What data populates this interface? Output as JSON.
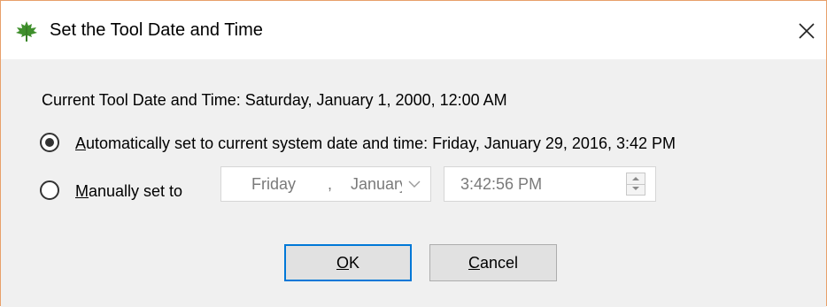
{
  "window": {
    "title": "Set the Tool Date and Time",
    "app_icon": "maple-leaf-icon",
    "close_icon": "close-icon",
    "accent_border_color": "#e8a06a"
  },
  "dialog": {
    "current_time_label": "Current Tool Date and Time: Saturday, January 1, 2000, 12:00 AM",
    "auto_option": {
      "label_mnemonic": "A",
      "label_rest": "utomatically set to current system date and time: Friday, January 29, 2016, 3:42 PM",
      "selected": true
    },
    "manual_option": {
      "label_mnemonic": "M",
      "label_rest": "anually set to",
      "selected": false
    },
    "date_picker": {
      "day": "Friday",
      "separator": ",",
      "month": "January",
      "dropdown_icon": "chevron-down-icon",
      "enabled": false
    },
    "time_picker": {
      "value": "3:42:56 PM",
      "spinner_icon": "spin-up-down-icon",
      "enabled": false
    },
    "buttons": {
      "ok_mnemonic": "O",
      "ok_rest": "K",
      "cancel_mnemonic": "C",
      "cancel_rest": "ancel",
      "default_color": "#0078d7"
    }
  }
}
